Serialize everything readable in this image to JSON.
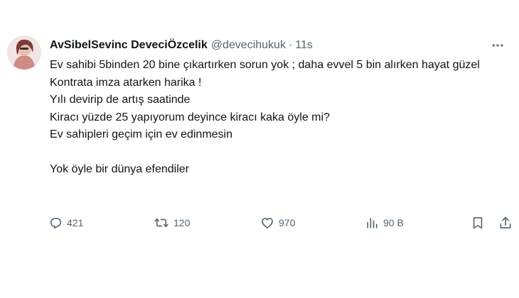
{
  "colors": {
    "text_primary": "#0f1419",
    "text_secondary": "#536471",
    "background": "#ffffff"
  },
  "author": {
    "display_name": "AvSibelSevinc DeveciÖzcelik",
    "handle": "@devecihukuk",
    "separator": "·",
    "time": "11s"
  },
  "tweet": {
    "lines": [
      "Ev sahibi 5binden 20 bine çıkartırken sorun yok ; daha evvel 5 bin alırken hayat güzel",
      "Kontrata imza atarken harika !",
      "Yılı devirip de artış saatinde",
      "Kiracı yüzde 25 yapıyorum deyince kiracı kaka öyle mi?",
      "Ev sahipleri geçim için ev edinmesin",
      "",
      "Yok öyle bir dünya efendiler"
    ]
  },
  "actions": {
    "replies": "421",
    "reposts": "120",
    "likes": "970",
    "views": "90 B"
  },
  "icons": {
    "more": "more-horizontal-icon",
    "reply": "reply-bubble-icon",
    "repost": "repost-arrows-icon",
    "like": "heart-icon",
    "views": "bar-chart-icon",
    "bookmark": "bookmark-icon",
    "share": "share-upload-icon"
  }
}
